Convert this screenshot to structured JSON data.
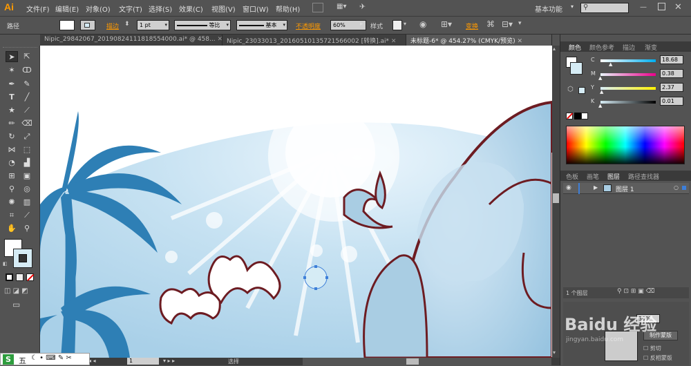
{
  "app": {
    "logo": "Ai",
    "workspace": "基本功能",
    "menu": [
      "文件(F)",
      "编辑(E)",
      "对象(O)",
      "文字(T)",
      "选择(S)",
      "效果(C)",
      "视图(V)",
      "窗口(W)",
      "帮助(H)"
    ]
  },
  "control_bar": {
    "selection_label": "路径",
    "stroke_label": "描边",
    "stroke_weight": "1 pt",
    "stroke_profile": "等比",
    "brush": "基本",
    "opacity_label": "不透明度",
    "opacity_value": "60%",
    "style_label": "样式",
    "transform_label": "变换"
  },
  "tabs": [
    {
      "label": "Nipic_29842067_20190824111818554000.ai* @ 458...",
      "active": false
    },
    {
      "label": "Nipic_23033013_20160510135721566002 [转换].ai*",
      "active": false
    },
    {
      "label": "未标题-6* @ 454.27% (CMYK/预览)",
      "active": true
    }
  ],
  "panels": {
    "color_tabs": [
      "颜色",
      "颜色参考",
      "描边",
      "渐变"
    ],
    "cmyk": [
      {
        "channel": "C",
        "value": "18.68",
        "fraction": 0.19,
        "gradient": "linear-gradient(to right,#ffffff,#00aeef)"
      },
      {
        "channel": "M",
        "value": "0.38",
        "fraction": 0.004,
        "gradient": "linear-gradient(to right,#eaf6fb,#ec008c)"
      },
      {
        "channel": "Y",
        "value": "2.37",
        "fraction": 0.024,
        "gradient": "linear-gradient(to right,#d9eef8,#fff200)"
      },
      {
        "channel": "K",
        "value": "0.01",
        "fraction": 0.0,
        "gradient": "linear-gradient(to right,#d6ecf5,#000000)"
      }
    ],
    "layer_tabs": [
      "色板",
      "画笔",
      "图层",
      "路径查找器"
    ],
    "layer_name": "图层 1",
    "layer_count": "1 个图层",
    "opacity_panel": {
      "value": "30%",
      "make_mask": "制作蒙版",
      "clip_label": "剪切",
      "invert_label": "反相蒙版"
    }
  },
  "status": {
    "zoom": "1",
    "tool": "选择"
  },
  "ime": {
    "label": "五"
  },
  "watermark": {
    "text": "经验",
    "url": "jingyan.baidu.com"
  },
  "colors": {
    "accent": "#ff9a00",
    "fill_swatch": "#d6ecf5",
    "elephant": "#a9cde3",
    "palm": "#2e7fb5",
    "outline": "#6d1c22"
  }
}
